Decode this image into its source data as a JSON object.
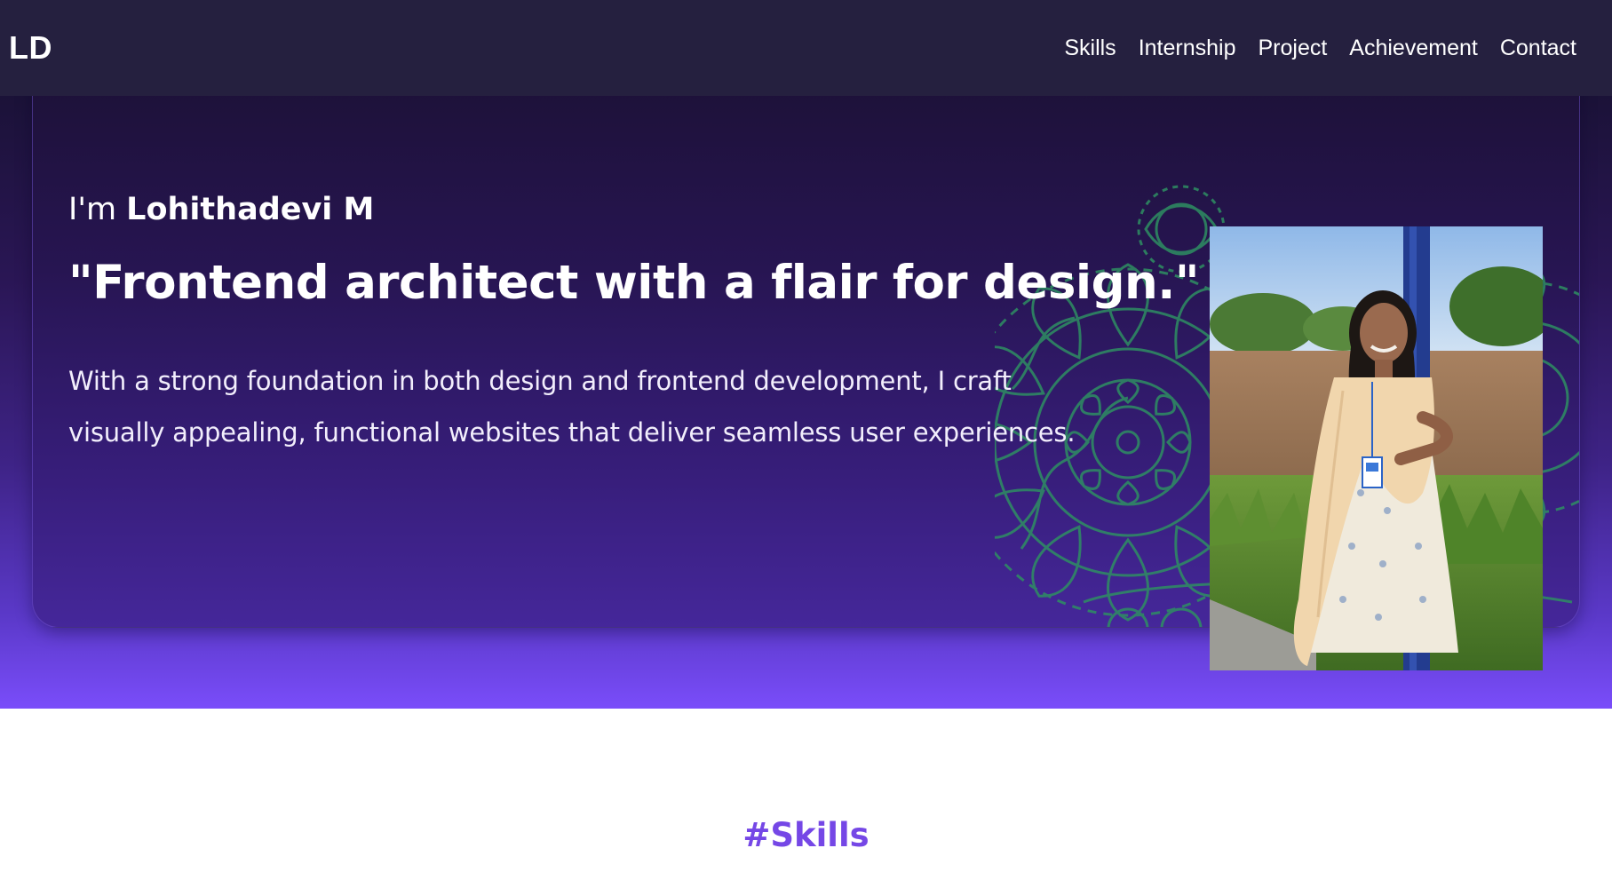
{
  "navbar": {
    "brand": "LD",
    "links": [
      "Skills",
      "Internship",
      "Project",
      "Achievement",
      "Contact"
    ]
  },
  "hero": {
    "intro_prefix": "I'm ",
    "name": "Lohithadevi M",
    "tagline": "\"Frontend architect with a flair for design.\"",
    "description": "With a strong foundation in both design and frontend development, I craft visually appealing, functional websites that deliver seamless user experiences."
  },
  "skills": {
    "heading": "#Skills"
  },
  "colors": {
    "navbar_bg": "#25203f",
    "hero_gradient_end": "#7a4dfa",
    "mandala": "#2f8f62",
    "skills_heading": "#7547e6"
  },
  "icons": {
    "decoration": "mandala-pattern",
    "photo": "profile-photo"
  }
}
